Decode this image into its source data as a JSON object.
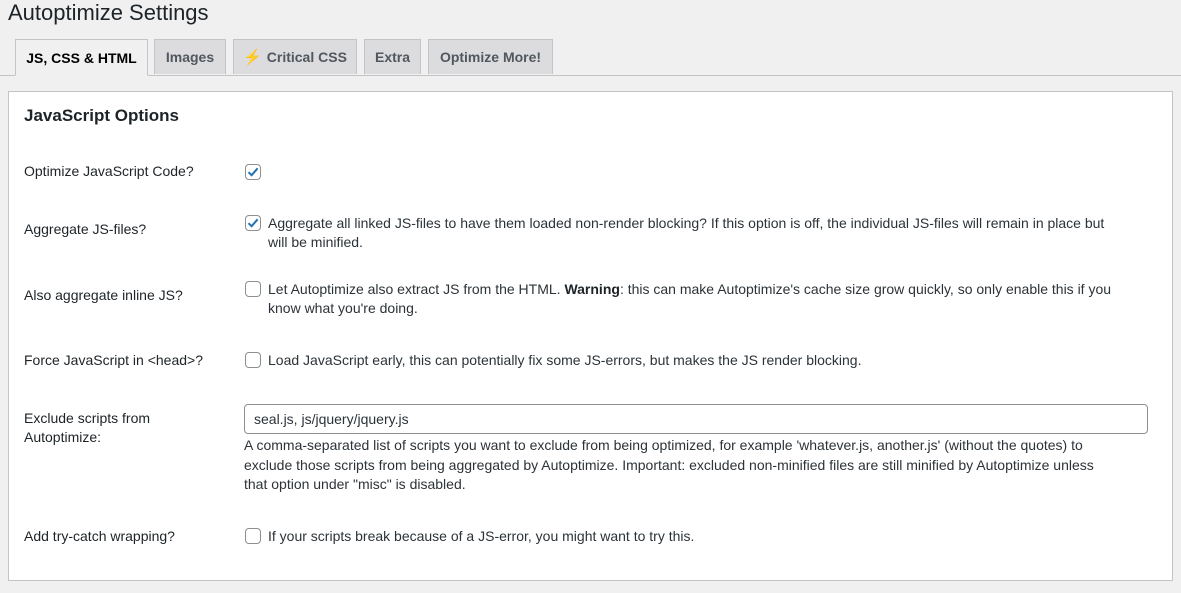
{
  "header": {
    "title": "Autoptimize Settings"
  },
  "tabs": [
    {
      "label": "JS, CSS & HTML",
      "active": true
    },
    {
      "label": "Images",
      "active": false
    },
    {
      "label": "Critical CSS",
      "active": false,
      "icon": "lightning-bolt-icon"
    },
    {
      "label": "Extra",
      "active": false
    },
    {
      "label": "Optimize More!",
      "active": false
    }
  ],
  "section": {
    "title": "JavaScript Options"
  },
  "options": {
    "optimize_js": {
      "label": "Optimize JavaScript Code?",
      "checked": true
    },
    "aggregate_js": {
      "label": "Aggregate JS-files?",
      "checked": true,
      "description_line1": "Aggregate all linked JS-files to have them loaded non-render blocking? If this option is off, the individual JS-files will remain in place but",
      "description_line2": "will be minified."
    },
    "inline_js": {
      "label": "Also aggregate inline JS?",
      "checked": false,
      "description_pre": "Let Autoptimize also extract JS from the HTML. ",
      "description_bold": "Warning",
      "description_post1": ": this can make Autoptimize's cache size grow quickly, so only enable this if you",
      "description_line2": "know what you're doing."
    },
    "force_head": {
      "label": "Force JavaScript in <head>?",
      "checked": false,
      "description": "Load JavaScript early, this can potentially fix some JS-errors, but makes the JS render blocking."
    },
    "exclude": {
      "label_line1": "Exclude scripts from",
      "label_line2": "Autoptimize:",
      "value": "seal.js, js/jquery/jquery.js",
      "help_line1": "A comma-separated list of scripts you want to exclude from being optimized, for example 'whatever.js, another.js' (without the quotes) to",
      "help_line2": "exclude those scripts from being aggregated by Autoptimize. Important: excluded non-minified files are still minified by Autoptimize unless",
      "help_line3": "that option under \"misc\" is disabled."
    },
    "try_catch": {
      "label": "Add try-catch wrapping?",
      "checked": false,
      "description": "If your scripts break because of a JS-error, you might want to try this."
    }
  },
  "colors": {
    "checkmark": "#2271b1",
    "accent_bolt": "#f0b849"
  }
}
